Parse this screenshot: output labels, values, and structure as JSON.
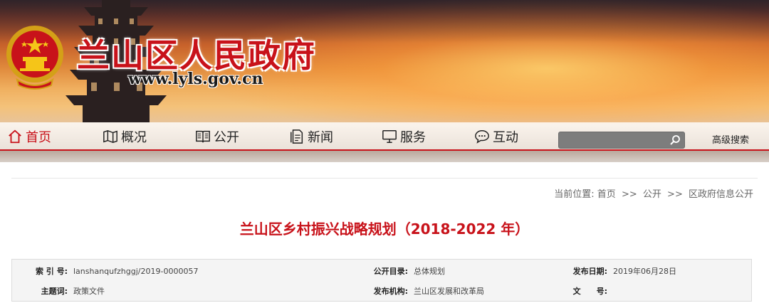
{
  "header": {
    "site_title": "兰山区人民政府",
    "site_url": "www.lyls.gov.cn"
  },
  "nav": {
    "items": [
      {
        "label": "首页",
        "icon": "home-icon",
        "active": true
      },
      {
        "label": "概况",
        "icon": "map-icon",
        "active": false
      },
      {
        "label": "公开",
        "icon": "book-icon",
        "active": false
      },
      {
        "label": "新闻",
        "icon": "document-icon",
        "active": false
      },
      {
        "label": "服务",
        "icon": "monitor-icon",
        "active": false
      },
      {
        "label": "互动",
        "icon": "chat-icon",
        "active": false
      }
    ],
    "search_value": "",
    "advanced_search_label": "高级搜索"
  },
  "breadcrumb": {
    "prefix": "当前位置:",
    "items": [
      "首页",
      "公开",
      "区政府信息公开"
    ],
    "separator": ">>"
  },
  "article": {
    "title": "兰山区乡村振兴战略规划（2018-2022 年）"
  },
  "meta": {
    "index_label": "索 引 号:",
    "index_value": "lanshanqufzhggj/2019-0000057",
    "catalog_label": "公开目录:",
    "catalog_value": "总体规划",
    "date_label": "发布日期:",
    "date_value": "2019年06月28日",
    "topic_label": "主题词:",
    "topic_value": "政策文件",
    "org_label": "发布机构:",
    "org_value": "兰山区发展和改革局",
    "docno_label": "文　　号:",
    "docno_value": ""
  },
  "colors": {
    "accent_red": "#c8121a",
    "meta_bg": "#f4f4f4",
    "search_bg": "#7d7d7d"
  }
}
